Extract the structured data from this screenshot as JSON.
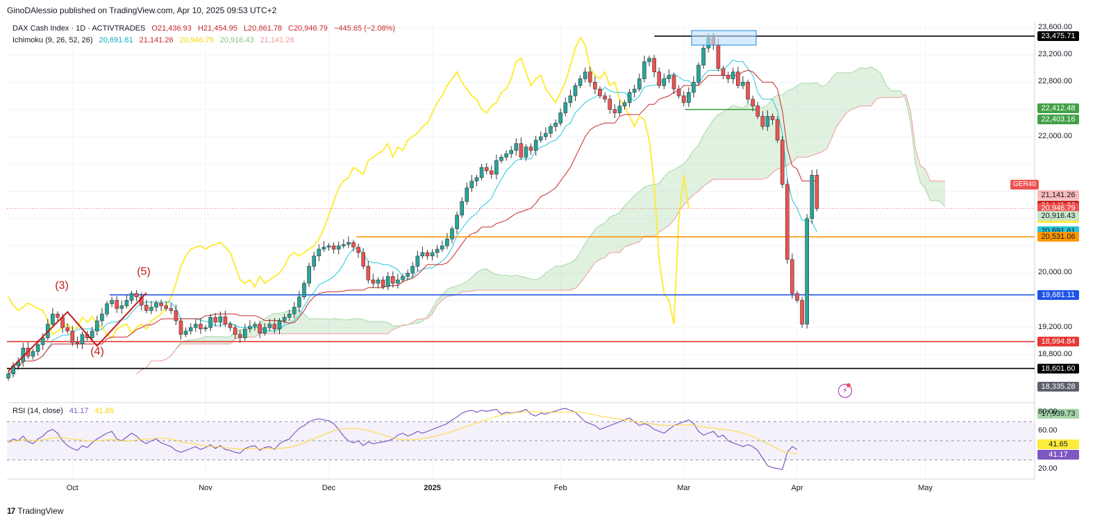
{
  "header": {
    "credit": "GinoDAlessio published on TradingView.com, Apr 10, 2025 09:53 UTC+2"
  },
  "brand": {
    "logo": "17",
    "name": "TradingView"
  },
  "legend_main": {
    "name": "DAX Cash Index · 1D · ACTIVTRADES",
    "open": "O21,436.93",
    "high": "H21,454.95",
    "low": "L20,861.78",
    "close": "C20,946.79",
    "change": "−445.65 (−2.08%)"
  },
  "legend_ichimoku": {
    "name": "Ichimoku (9, 26, 52, 26)",
    "v1": "20,691.61",
    "v2": "21,141.26",
    "v3": "20,946.79",
    "v4": "20,916.43",
    "v5": "21,141.26"
  },
  "legend_rsi": {
    "name": "RSI (14, close)",
    "v1": "41.17",
    "v2": "41.65"
  },
  "symbol_tag": "GER40",
  "wave_labels": [
    "(3)",
    "(4)",
    "(5)"
  ],
  "colors": {
    "up": "#26a69a",
    "down": "#ef5350",
    "conversion": "#26c6da",
    "base": "#c62828",
    "lagging": "#ffeb3b",
    "cloud_a": "#a5d6a7",
    "cloud_b": "#ef9a9a",
    "rsi": "#7e57c2",
    "rsi_ma": "#fdd835"
  },
  "chart_data": {
    "type": "candlestick",
    "title": "DAX Cash Index · 1D · ACTIVTRADES",
    "y_ticks": [
      "23,600.00",
      "23,200.00",
      "22,800.00",
      "22,000.00",
      "19,200.00",
      "18,800.00",
      "20,000.00"
    ],
    "x_ticks": [
      "Oct",
      "Nov",
      "Dec",
      "2025",
      "Feb",
      "Mar",
      "Apr",
      "May"
    ],
    "ylim": [
      18150,
      23700
    ],
    "price_labels": [
      {
        "text": "23,475.71",
        "value": 23475.71,
        "bg": "#000000",
        "fg": "#ffffff"
      },
      {
        "text": "22,412.48",
        "value": 22412.48,
        "bg": "#43a047",
        "fg": "#ffffff"
      },
      {
        "text": "22,403.16",
        "value": 22403.16,
        "bg": "#43a047",
        "fg": "#ffffff"
      },
      {
        "text": "21,141.26",
        "value": 21141.26,
        "bg": "#f8bbbb",
        "fg": "#131722"
      },
      {
        "text": "21,141.26",
        "value": 21141.26,
        "bg": "#c62828",
        "fg": "#ffffff"
      },
      {
        "text": "20,946.79",
        "value": 20946.79,
        "bg": "#ef5350",
        "fg": "#ffffff"
      },
      {
        "text": "12:06:44",
        "value": 20946.79,
        "bg": "#ef5350",
        "fg": "#ffffff"
      },
      {
        "text": "20,946.79",
        "value": 20946.79,
        "bg": "#ffeb3b",
        "fg": "#131722"
      },
      {
        "text": "20,916.43",
        "value": 20916.43,
        "bg": "#c8e6c9",
        "fg": "#131722"
      },
      {
        "text": "20,691.61",
        "value": 20691.61,
        "bg": "#26c6da",
        "fg": "#131722"
      },
      {
        "text": "20,531.06",
        "value": 20531.06,
        "bg": "#ff9800",
        "fg": "#131722"
      },
      {
        "text": "19,681.11",
        "value": 19681.11,
        "bg": "#1e53e5",
        "fg": "#ffffff"
      },
      {
        "text": "18,994.84",
        "value": 18994.84,
        "bg": "#e53935",
        "fg": "#ffffff"
      },
      {
        "text": "18,601.60",
        "value": 18601.6,
        "bg": "#000000",
        "fg": "#ffffff"
      },
      {
        "text": "18,335.28",
        "value": 18335.28,
        "bg": "#5d6069",
        "fg": "#ffffff"
      },
      {
        "text": "17,939.73",
        "value": 17939.73,
        "bg": "#a5d6a7",
        "fg": "#131722"
      }
    ],
    "rsi_ticks": [
      "80.00",
      "60.00",
      "20.00"
    ],
    "rsi_labels": [
      {
        "text": "41.65",
        "value": 41.65,
        "bg": "#ffeb3b",
        "fg": "#131722"
      },
      {
        "text": "41.17",
        "value": 41.17,
        "bg": "#7e57c2",
        "fg": "#ffffff"
      }
    ],
    "hlines": [
      {
        "value": 23475.71,
        "color": "#000000",
        "from": 0.63,
        "to": 1.0
      },
      {
        "value": 20531.06,
        "color": "#ff9800",
        "from": 0.34,
        "to": 1.0
      },
      {
        "value": 19681.11,
        "color": "#1e53e5",
        "from": 0.1,
        "to": 1.0
      },
      {
        "value": 18994.84,
        "color": "#e53935",
        "from": 0.0,
        "to": 1.0
      },
      {
        "value": 18601.6,
        "color": "#000000",
        "from": 0.0,
        "to": 1.0
      },
      {
        "value": 22400,
        "color": "#43a047",
        "from": 0.66,
        "to": 0.73
      }
    ],
    "closes": [
      18520,
      18640,
      18700,
      18900,
      18780,
      18850,
      18950,
      19050,
      19250,
      19400,
      19350,
      19200,
      19150,
      18980,
      18960,
      19100,
      19050,
      19150,
      19300,
      19400,
      19550,
      19600,
      19480,
      19520,
      19600,
      19700,
      19650,
      19530,
      19450,
      19500,
      19560,
      19520,
      19480,
      19450,
      19300,
      19100,
      19150,
      19200,
      19250,
      19180,
      19200,
      19350,
      19280,
      19360,
      19250,
      19200,
      19100,
      19050,
      19180,
      19220,
      19250,
      19120,
      19200,
      19250,
      19180,
      19300,
      19350,
      19400,
      19500,
      19650,
      19850,
      20100,
      20250,
      20350,
      20380,
      20400,
      20350,
      20400,
      20420,
      20450,
      20380,
      20300,
      20100,
      19900,
      19850,
      19900,
      19800,
      19950,
      19850,
      19900,
      19950,
      20000,
      20100,
      20250,
      20300,
      20250,
      20300,
      20350,
      20400,
      20500,
      20650,
      20850,
      21050,
      21250,
      21350,
      21400,
      21550,
      21500,
      21450,
      21650,
      21700,
      21750,
      21800,
      21900,
      21700,
      21850,
      21800,
      21950,
      22000,
      22050,
      22150,
      22200,
      22350,
      22500,
      22600,
      22750,
      22850,
      22950,
      22800,
      22700,
      22600,
      22550,
      22400,
      22350,
      22450,
      22500,
      22650,
      22700,
      22850,
      23100,
      23150,
      22950,
      22750,
      22850,
      22900,
      22700,
      22600,
      22500,
      22650,
      22800,
      23050,
      23300,
      23450,
      23350,
      23000,
      22900,
      22850,
      22950,
      22750,
      22800,
      22550,
      22450,
      22300,
      22150,
      22300,
      22250,
      21950,
      21300,
      20200,
      19700,
      19600,
      19250,
      20800,
      21436,
      20946
    ],
    "rsi": [
      48,
      52,
      50,
      55,
      49,
      47,
      52,
      55,
      60,
      62,
      58,
      50,
      45,
      42,
      40,
      45,
      43,
      48,
      52,
      55,
      58,
      60,
      52,
      50,
      54,
      58,
      55,
      50,
      47,
      50,
      52,
      48,
      46,
      44,
      40,
      38,
      40,
      42,
      44,
      41,
      43,
      46,
      42,
      45,
      41,
      40,
      38,
      37,
      42,
      44,
      45,
      40,
      43,
      44,
      41,
      47,
      50,
      52,
      58,
      63,
      66,
      70,
      72,
      73,
      72,
      71,
      68,
      62,
      55,
      50,
      48,
      50,
      45,
      49,
      47,
      48,
      49,
      50,
      52,
      56,
      58,
      55,
      57,
      60,
      58,
      60,
      62,
      64,
      66,
      68,
      72,
      75,
      79,
      81,
      82,
      80,
      82,
      81,
      82,
      83,
      78,
      80,
      79,
      80,
      81,
      83,
      78,
      76,
      79,
      78,
      80,
      81,
      83,
      84,
      82,
      80,
      75,
      70,
      68,
      66,
      62,
      64,
      66,
      68,
      70,
      72,
      74,
      70,
      66,
      68,
      66,
      62,
      60,
      58,
      62,
      66,
      68,
      70,
      72,
      68,
      60,
      56,
      58,
      60,
      54,
      56,
      50,
      48,
      46,
      44,
      46,
      44,
      40,
      32,
      24,
      22,
      21,
      20,
      38,
      44,
      41
    ]
  }
}
